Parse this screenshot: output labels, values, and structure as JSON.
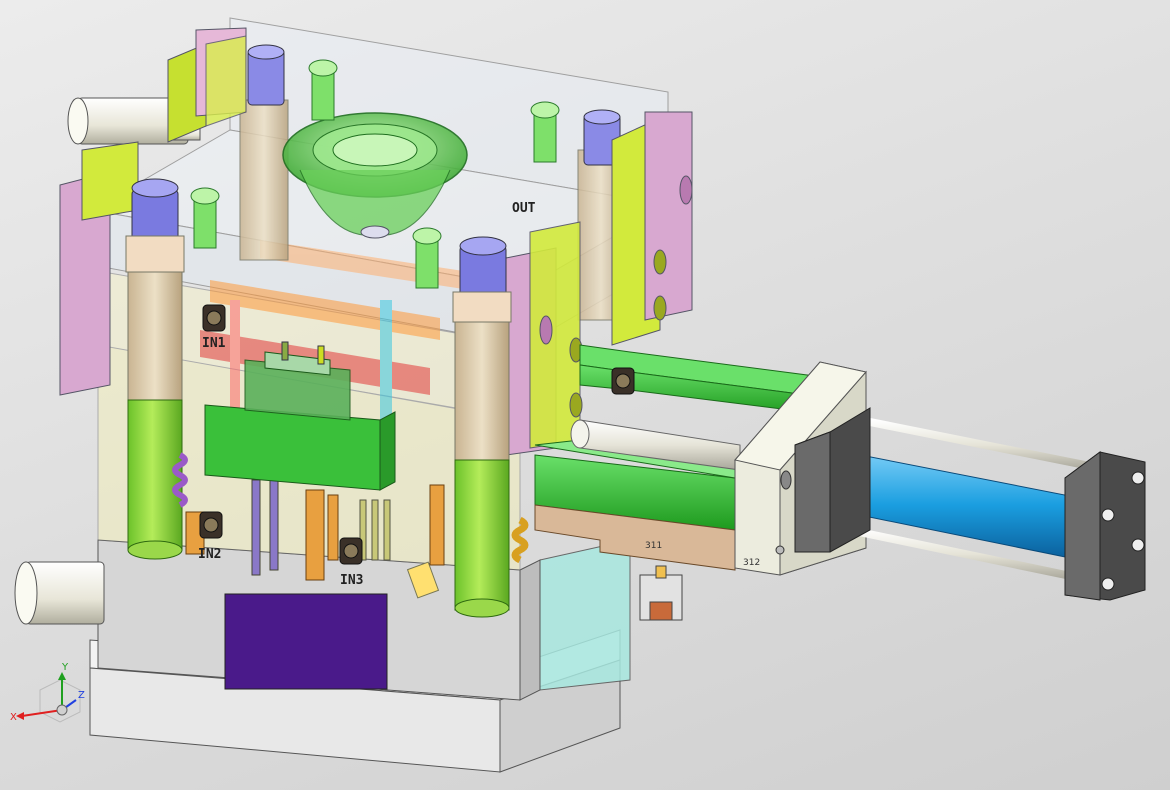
{
  "viewport": {
    "background_top": "#ececec",
    "background_bottom": "#cfcfcf"
  },
  "model": {
    "callouts": {
      "in1": "IN1",
      "in2": "IN2",
      "in3": "IN3",
      "out": "OUT",
      "tag_311": "311",
      "tag_312": "312"
    },
    "colors": {
      "clamp_plate": "#f0f0f0",
      "guide_pillar": "#a8e04a",
      "pillar_sleeve": "#f2dcc2",
      "pillar_cap": "#7a7ae0",
      "pink_block": "#d8a8d0",
      "yellow_block": "#d2ea3c",
      "green_rail": "#38c238",
      "slider": "#d9b898",
      "cylinder": "#1a9ee0",
      "cylinder_flange": "#555555",
      "nameplate": "#4a1a8a",
      "part_shell": "#52c852"
    }
  },
  "triad": {
    "x_label": "X",
    "y_label": "Y",
    "z_label": "Z",
    "x_color": "#e02020",
    "y_color": "#20a020",
    "z_color": "#2040e0"
  }
}
